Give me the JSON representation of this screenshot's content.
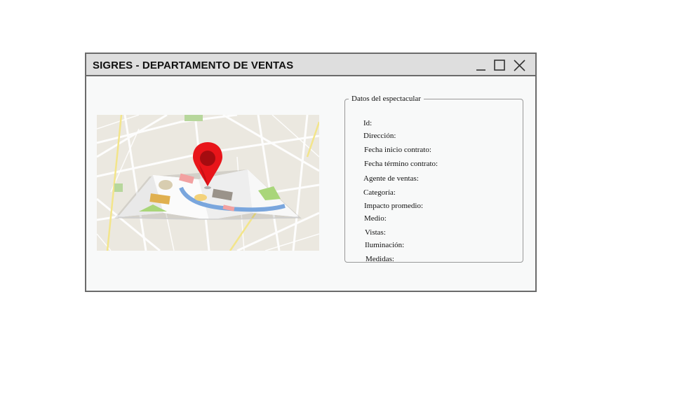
{
  "window": {
    "title": "SIGRES - DEPARTAMENTO DE VENTAS",
    "controls": [
      "minimize-icon",
      "maximize-icon",
      "close-icon"
    ]
  },
  "map_image": {
    "icon": "map-with-location-pin",
    "pin_color": "#e8151a"
  },
  "details": {
    "legend": "Datos del espectacular",
    "fields": [
      {
        "label": "Id:"
      },
      {
        "label": "Dirección:"
      },
      {
        "label": "Fecha inicio contrato:"
      },
      {
        "label": "Fecha término contrato:"
      },
      {
        "label": "Agente de ventas:"
      },
      {
        "label": "Categoría:"
      },
      {
        "label": "Impacto promedio:"
      },
      {
        "label": "Medio:"
      },
      {
        "label": "Vistas:"
      },
      {
        "label": "Iluminación:"
      },
      {
        "label": "Medidas:"
      }
    ]
  }
}
